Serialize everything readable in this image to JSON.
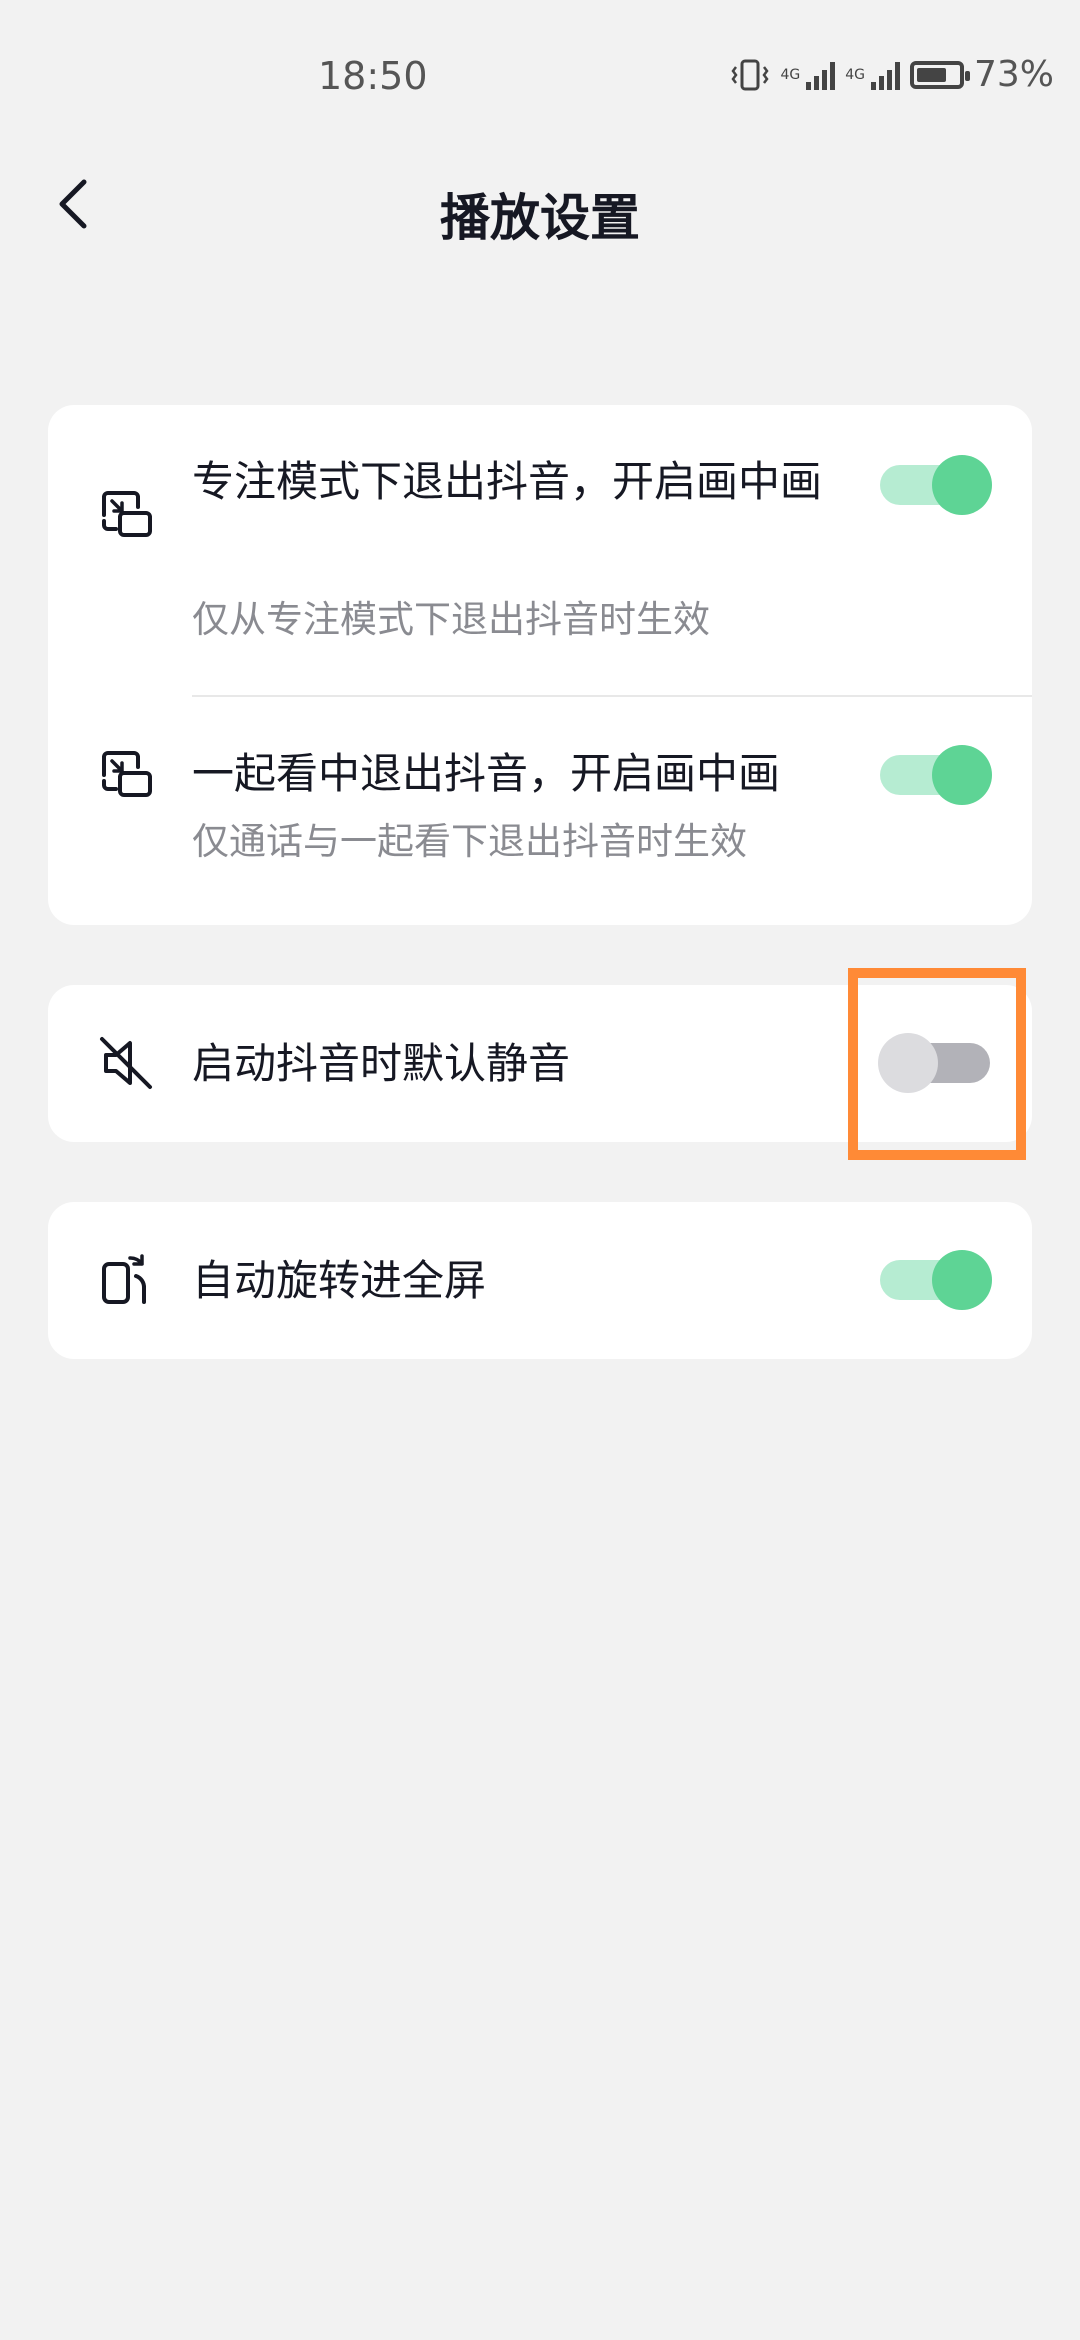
{
  "status_bar": {
    "time": "18:50",
    "network_1": "4G",
    "network_2": "4G",
    "battery_level": 0.73,
    "battery_percent": "73%"
  },
  "header": {
    "back_icon": "chevron-left-icon",
    "title": "播放设置"
  },
  "settings": [
    {
      "icon": "picture-in-picture-icon",
      "title": "专注模式下退出抖音，开启画中画",
      "description": "仅从专注模式下退出抖音时生效",
      "enabled": true
    },
    {
      "icon": "picture-in-picture-icon",
      "title": "一起看中退出抖音，开启画中画",
      "description": "仅通话与一起看下退出抖音时生效",
      "enabled": true
    },
    {
      "icon": "mute-speaker-icon",
      "title": "启动抖音时默认静音",
      "enabled": false
    },
    {
      "icon": "rotate-screen-icon",
      "title": "自动旋转进全屏",
      "enabled": true
    }
  ],
  "colors": {
    "background": "#f2f2f2",
    "card": "#ffffff",
    "toggle_on_knob": "#5ed495",
    "toggle_on_track": "#b6ecd2",
    "toggle_off_knob": "#dcdcdf",
    "toggle_off_track": "#b2b2b8",
    "highlight": "#ff8a36"
  }
}
